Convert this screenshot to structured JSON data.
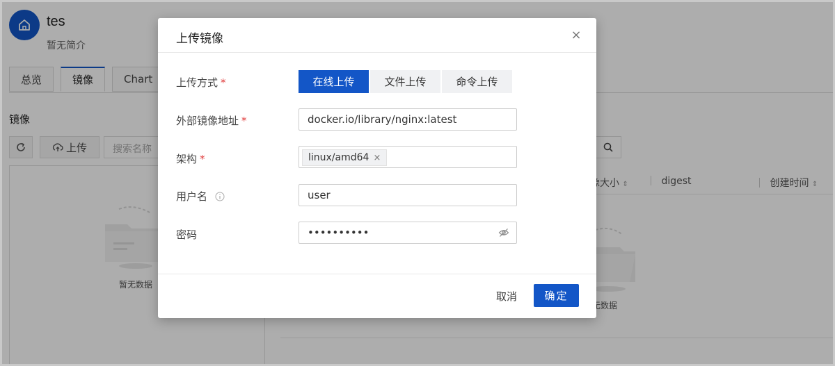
{
  "app": {
    "name": "tes",
    "description": "暂无简介"
  },
  "tabs": [
    {
      "label": "总览"
    },
    {
      "label": "镜像"
    },
    {
      "label": "Chart"
    }
  ],
  "images": {
    "section_title": "镜像",
    "upload_label": "上传",
    "search_placeholder": "搜索名称",
    "empty_text": "暂无数据",
    "empty_text_right": "无数据",
    "columns": {
      "size": "像大小",
      "digest": "digest",
      "created": "创建时间"
    }
  },
  "modal": {
    "title": "上传镜像",
    "close": "×",
    "upload_method": {
      "label": "上传方式",
      "required": "*",
      "options": [
        "在线上传",
        "文件上传",
        "命令上传"
      ],
      "selected": "在线上传"
    },
    "image_address": {
      "label": "外部镜像地址",
      "required": "*",
      "value": "docker.io/library/nginx:latest"
    },
    "arch": {
      "label": "架构",
      "required": "*",
      "tag": "linux/amd64",
      "tag_remove": "×"
    },
    "username": {
      "label": "用户名",
      "value": "user"
    },
    "password": {
      "label": "密码",
      "value": "••••••••••"
    },
    "cancel_label": "取消",
    "ok_label": "确定"
  },
  "colors": {
    "primary": "#1356c7",
    "required": "#e03b3b"
  }
}
